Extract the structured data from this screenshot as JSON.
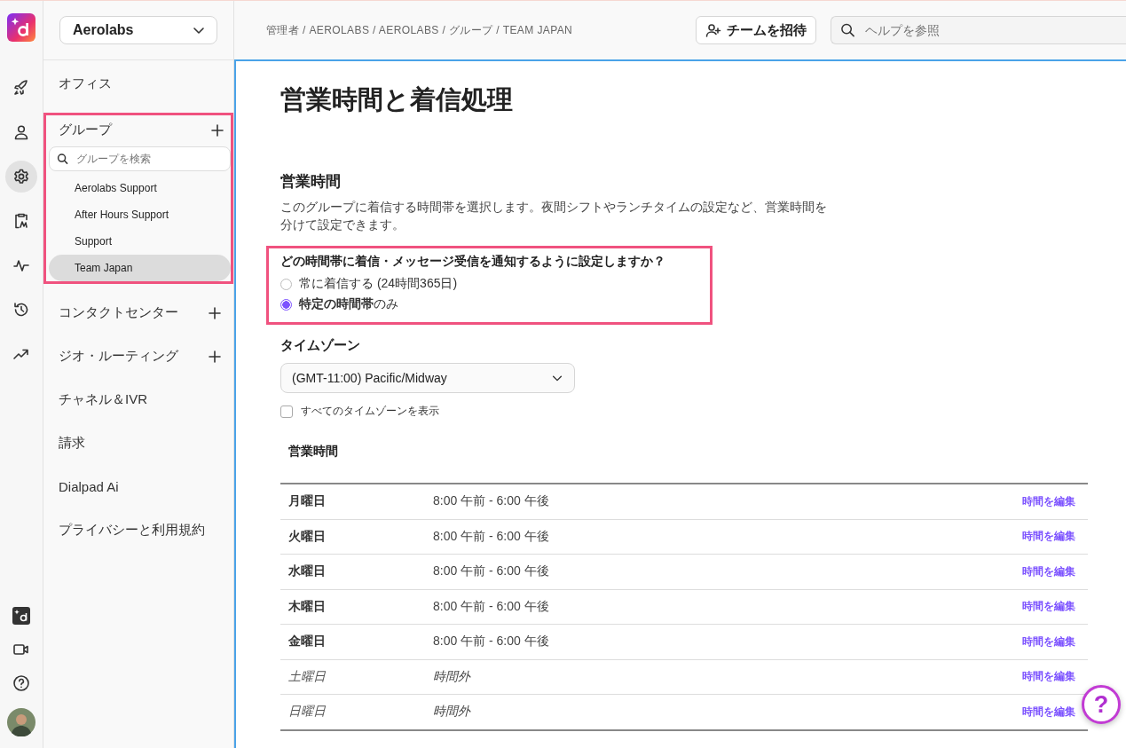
{
  "rail": {
    "items": [
      {
        "kind": "rocket",
        "selected": false
      },
      {
        "kind": "person",
        "selected": false
      },
      {
        "kind": "gear",
        "selected": true
      },
      {
        "kind": "clipboard",
        "selected": false
      },
      {
        "kind": "pulse",
        "selected": false
      },
      {
        "kind": "history",
        "selected": false
      },
      {
        "kind": "trend",
        "selected": false
      }
    ],
    "bottom": [
      {
        "kind": "ai"
      },
      {
        "kind": "video"
      },
      {
        "kind": "help"
      },
      {
        "kind": "avatar"
      }
    ]
  },
  "sidebar": {
    "account": "Aerolabs",
    "sections": [
      {
        "label": "オフィス",
        "addable": false,
        "highlighted": false
      },
      {
        "label": "グループ",
        "addable": true,
        "highlighted": true,
        "search_placeholder": "グループを検索",
        "children": [
          {
            "label": "Aerolabs Support",
            "selected": false
          },
          {
            "label": "After Hours Support",
            "selected": false
          },
          {
            "label": "Support",
            "selected": false
          },
          {
            "label": "Team Japan",
            "selected": true
          }
        ]
      },
      {
        "label": "コンタクトセンター",
        "addable": true,
        "highlighted": false
      },
      {
        "label": "ジオ・ルーティング",
        "addable": true,
        "highlighted": false
      },
      {
        "label": "チャネル＆IVR",
        "addable": false,
        "highlighted": false
      },
      {
        "label": "請求",
        "addable": false,
        "highlighted": false
      },
      {
        "label": "Dialpad Ai",
        "addable": false,
        "highlighted": false
      },
      {
        "label": "プライバシーと利用規約",
        "addable": false,
        "highlighted": false
      }
    ]
  },
  "topbar": {
    "breadcrumb": "管理者 / AEROLABS / AEROLABS / グループ / TEAM JAPAN",
    "invite_button": "チームを招待",
    "search_placeholder": "ヘルプを参照"
  },
  "page": {
    "title": "営業時間と着信処理",
    "section_title": "営業時間",
    "description": "このグループに着信する時間帯を選択します。夜間シフトやランチタイムの設定など、営業時間を分けて設定できます。",
    "question": {
      "label": "どの時間帯に着信・メッセージ受信を通知するように設定しますか？",
      "highlighted": true,
      "options": [
        {
          "label": "常に着信する (24時間365日)",
          "selected": false
        },
        {
          "label": "**特定の時間帯**のみ",
          "selected": true
        }
      ]
    },
    "timezone": {
      "label": "タイムゾーン",
      "value": "(GMT-11:00) Pacific/Midway",
      "show_all": {
        "label": "すべてのタイムゾーンを表示",
        "checked": false
      }
    },
    "hours_table": {
      "title": "営業時間",
      "rows": [
        {
          "day": "月曜日",
          "hours": "8:00 午前 - 6:00 午後",
          "closed": false,
          "action": "時間を編集"
        },
        {
          "day": "火曜日",
          "hours": "8:00 午前 - 6:00 午後",
          "closed": false,
          "action": "時間を編集"
        },
        {
          "day": "水曜日",
          "hours": "8:00 午前 - 6:00 午後",
          "closed": false,
          "action": "時間を編集"
        },
        {
          "day": "木曜日",
          "hours": "8:00 午前 - 6:00 午後",
          "closed": false,
          "action": "時間を編集"
        },
        {
          "day": "金曜日",
          "hours": "8:00 午前 - 6:00 午後",
          "closed": false,
          "action": "時間を編集"
        },
        {
          "day": "土曜日",
          "hours": "時間外",
          "closed": true,
          "action": "時間を編集"
        },
        {
          "day": "日曜日",
          "hours": "時間外",
          "closed": true,
          "action": "時間を編集"
        }
      ]
    }
  },
  "help_fab": "?"
}
